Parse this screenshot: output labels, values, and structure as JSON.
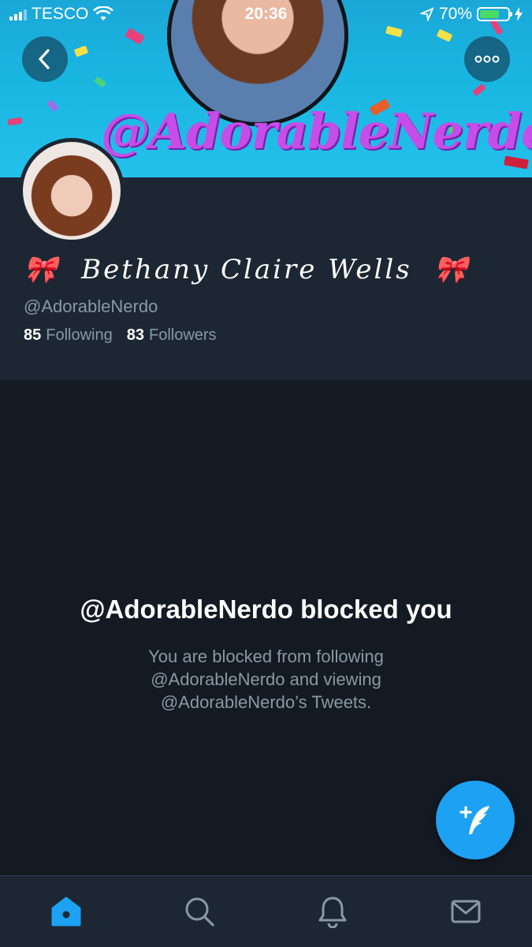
{
  "status_bar": {
    "carrier": "TESCO",
    "time": "20:36",
    "battery": "70%",
    "battery_level": 0.7
  },
  "banner": {
    "text": "@AdorableNerdo"
  },
  "profile": {
    "display_name": "Bethany Claire Wells",
    "decoration_emoji": "🎀",
    "handle": "@AdorableNerdo",
    "following_count": "85",
    "following_label": "Following",
    "followers_count": "83",
    "followers_label": "Followers"
  },
  "blocked": {
    "title": "@AdorableNerdo blocked you",
    "line1": "You are blocked from following",
    "line2": "@AdorableNerdo and viewing",
    "line3": "@AdorableNerdo’s Tweets."
  },
  "icons": {
    "back": "back-chevron-icon",
    "more": "more-dots-icon",
    "compose": "compose-feather-icon",
    "home": "home-icon",
    "search": "search-icon",
    "notifications": "bell-icon",
    "messages": "mail-icon"
  },
  "colors": {
    "accent": "#1da1f2",
    "background": "#141a22",
    "header_bg": "#1c2733",
    "secondary_text": "#8899a6",
    "banner_text": "#c64de8"
  }
}
